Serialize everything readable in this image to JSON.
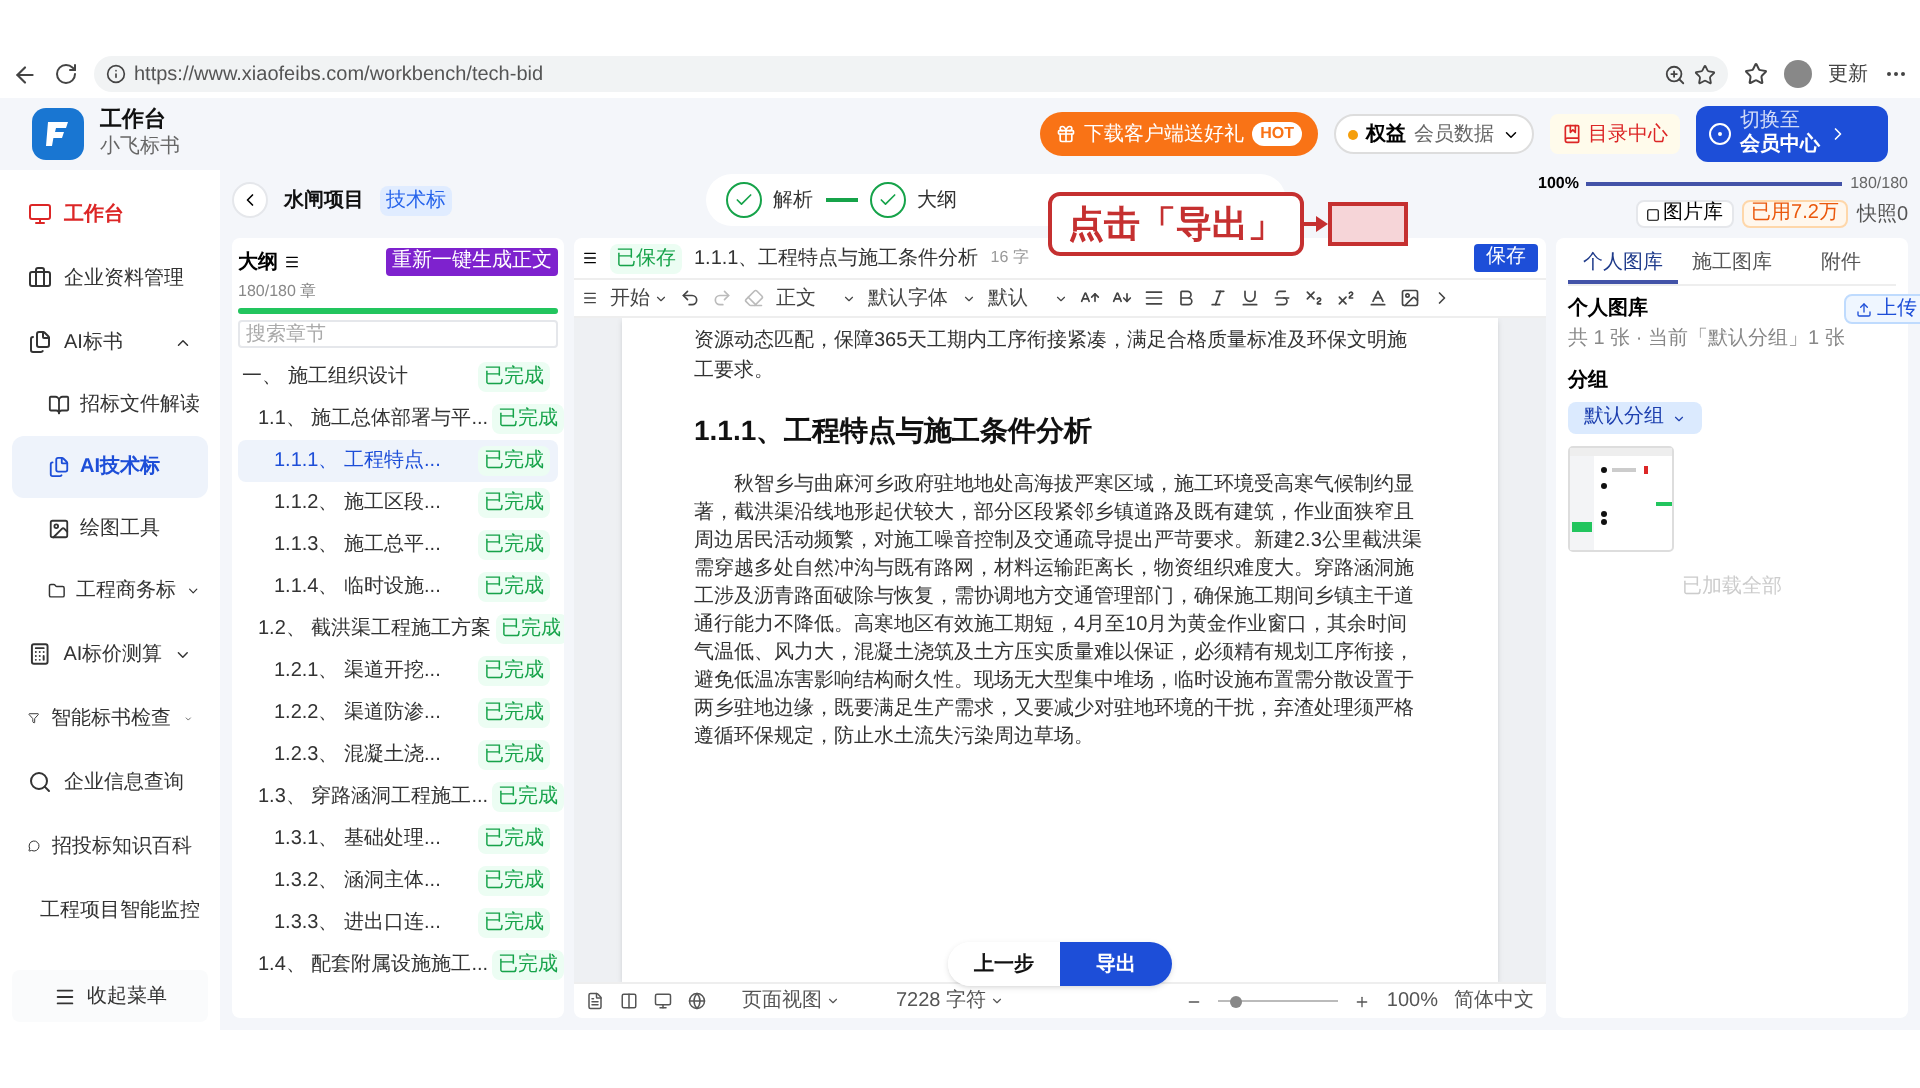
{
  "browser": {
    "url": "https://www.xiaofeibs.com/workbench/tech-bid",
    "profile_label": "更新"
  },
  "header": {
    "app_title": "工作台",
    "app_subtitle": "小飞标书",
    "promo": {
      "label": "下载客户端送好礼",
      "badge": "HOT"
    },
    "member_data": {
      "label": "权益",
      "value": "会员数据"
    },
    "catalog": "目录中心",
    "member_center": {
      "caption": "切换至",
      "label": "会员中心"
    }
  },
  "sidebar": {
    "home": "工作台",
    "items": [
      {
        "label": "企业资料管理"
      },
      {
        "label": "AI标书",
        "expanded": true,
        "children": [
          {
            "label": "招标文件解读",
            "selected": false
          },
          {
            "label": "AI技术标",
            "selected": true
          },
          {
            "label": "绘图工具",
            "selected": false
          },
          {
            "label": "工程商务标",
            "selected": false,
            "expanded": false
          }
        ]
      },
      {
        "label": "AI标价测算",
        "expanded": false
      },
      {
        "label": "智能标书检查",
        "expanded": false
      },
      {
        "label": "企业信息查询"
      },
      {
        "label": "招投标知识百科"
      },
      {
        "label": "工程项目智能监控"
      }
    ],
    "collapse": "收起菜单"
  },
  "project": {
    "name": "水闸项目",
    "badge": "技术标",
    "steps": [
      {
        "label": "解析",
        "done": true
      },
      {
        "label": "大纲",
        "done": true
      }
    ]
  },
  "top_right": {
    "progress_label": "100%",
    "level": 1,
    "count": "180/180",
    "gallery_button": "图片库",
    "usage": "已用7.2万",
    "snapshot": "快照0"
  },
  "outline": {
    "title": "大纲",
    "regen_button": "重新一键生成正文",
    "count": "180/180 章",
    "level": 1,
    "search_placeholder": "搜索章节",
    "items": [
      {
        "number": "一、",
        "title": "施工组织设计",
        "status": "已完成",
        "selected": false,
        "children": [
          {
            "number": "1.1、",
            "title": "施工总体部署与平...",
            "status": "已完成",
            "selected": false,
            "children": [
              {
                "number": "1.1.1、",
                "title": "工程特点...",
                "status": "已完成",
                "selected": true
              },
              {
                "number": "1.1.2、",
                "title": "施工区段...",
                "status": "已完成",
                "selected": false
              },
              {
                "number": "1.1.3、",
                "title": "施工总平...",
                "status": "已完成",
                "selected": false
              },
              {
                "number": "1.1.4、",
                "title": "临时设施...",
                "status": "已完成",
                "selected": false
              }
            ]
          },
          {
            "number": "1.2、",
            "title": "截洪渠工程施工方案",
            "status": "已完成",
            "selected": false,
            "children": [
              {
                "number": "1.2.1、",
                "title": "渠道开挖...",
                "status": "已完成",
                "selected": false
              },
              {
                "number": "1.2.2、",
                "title": "渠道防渗...",
                "status": "已完成",
                "selected": false
              },
              {
                "number": "1.2.3、",
                "title": "混凝土浇...",
                "status": "已完成",
                "selected": false
              }
            ]
          },
          {
            "number": "1.3、",
            "title": "穿路涵洞工程施工...",
            "status": "已完成",
            "selected": false,
            "children": [
              {
                "number": "1.3.1、",
                "title": "基础处理...",
                "status": "已完成",
                "selected": false
              },
              {
                "number": "1.3.2、",
                "title": "涵洞主体...",
                "status": "已完成",
                "selected": false
              },
              {
                "number": "1.3.3、",
                "title": "进出口连...",
                "status": "已完成",
                "selected": false
              }
            ]
          },
          {
            "number": "1.4、",
            "title": "配套附属设施施工...",
            "status": "已完成",
            "selected": false
          }
        ]
      }
    ]
  },
  "editor": {
    "save_status": "已保存",
    "doc_title": "1.1.1、工程特点与施工条件分析",
    "word_count": "16 字",
    "save_button": "保存",
    "toolbar": {
      "menu": "开始",
      "style": "正文",
      "font": "默认字体",
      "size": "默认"
    },
    "doc": {
      "intro": "资源动态匹配，保障365天工期内工序衔接紧凑，满足合格质量标准及环保文明施工要求。",
      "heading": "1.1.1、工程特点与施工条件分析",
      "paragraph": "秋智乡与曲麻河乡政府驻地地处高海拔严寒区域，施工环境受高寒气候制约显著，截洪渠沿线地形起伏较大，部分区段紧邻乡镇道路及既有建筑，作业面狭窄且周边居民活动频繁，对施工噪音控制及交通疏导提出严苛要求。新建2.3公里截洪渠需穿越多处自然冲沟与既有路网，材料运输距离长，物资组织难度大。穿路涵洞施工涉及沥青路面破除与恢复，需协调地方交通管理部门，确保施工期间乡镇主干道通行能力不降低。高寒地区有效施工期短，4月至10月为黄金作业窗口，其余时间气温低、风力大，混凝土浇筑及土方压实质量难以保证，必须精有规划工序衔接，避免低温冻害影响结构耐久性。现场无大型集中堆场，临时设施布置需分散设置于两乡驻地边缘，既要满足生产需求，又要减少对驻地环境的干扰，弃渣处理须严格遵循环保规定，防止水土流失污染周边草场。"
    },
    "status_bar": {
      "view": "页面视图",
      "chars": "7228 字符",
      "zoom_slider": {
        "level": 0.15
      },
      "zoom": "100%",
      "language": "简体中文"
    },
    "nav": {
      "prev": "上一步",
      "export": "导出"
    }
  },
  "gallery": {
    "tabs": [
      {
        "label": "个人图库",
        "selected": true
      },
      {
        "label": "施工图库",
        "selected": false
      },
      {
        "label": "附件",
        "selected": false
      }
    ],
    "title": "个人图库",
    "summary": "共 1 张 · 当前「默认分组」1 张",
    "upload_button": "上传",
    "group_label": "分组",
    "group_select": "默认分组",
    "footer": "已加载全部"
  },
  "annotation": {
    "callout": "点击「导出」"
  }
}
